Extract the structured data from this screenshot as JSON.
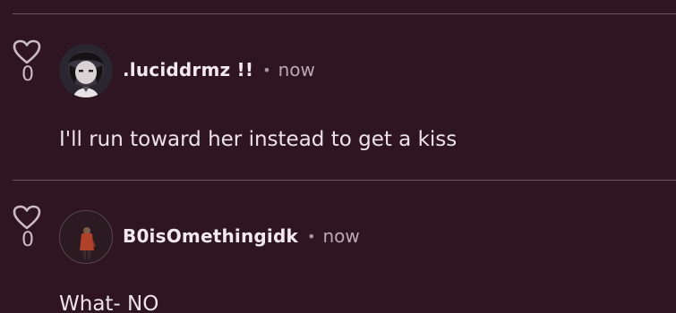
{
  "comments": [
    {
      "likes": "0",
      "username": ".luciddrmz !!",
      "separator": "•",
      "time": "now",
      "text": "I'll run toward her instead to get a kiss"
    },
    {
      "likes": "0",
      "username": "B0isOmethingidk",
      "separator": "•",
      "time": "now",
      "text": "What- NO"
    }
  ],
  "colors": {
    "background": "#2f1522",
    "divider": "#6b5560",
    "text": "#ece2e7",
    "muted": "#b9a9b1"
  },
  "icons": {
    "like": "heart-outline-icon"
  }
}
